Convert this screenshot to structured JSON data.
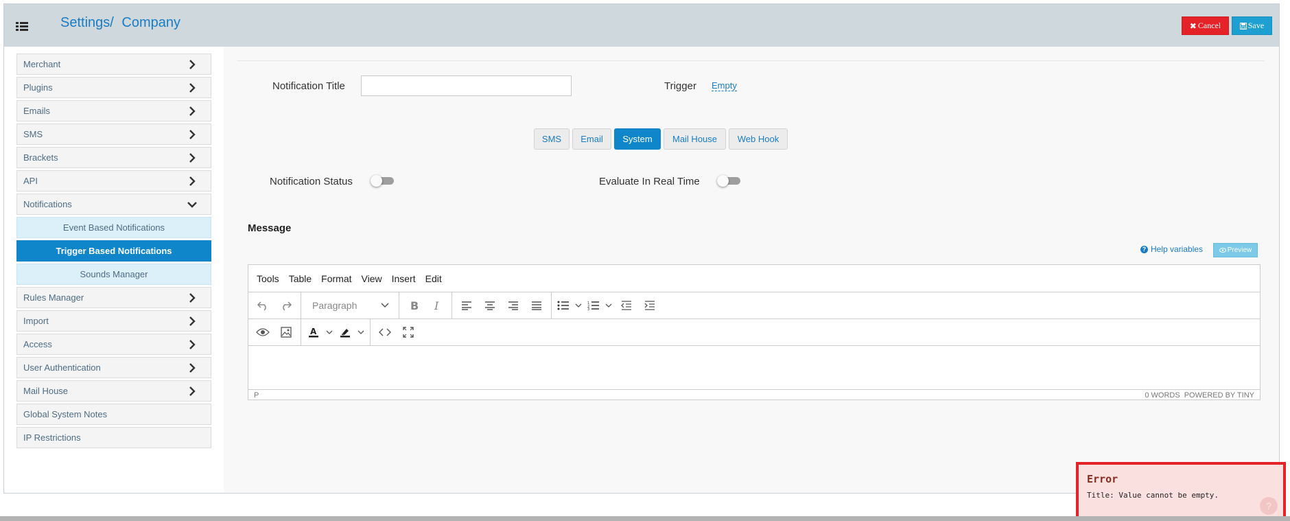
{
  "header": {
    "breadcrumb_root": "Settings/",
    "breadcrumb_current": "Company",
    "cancel_label": "Cancel",
    "save_label": "Save"
  },
  "sidebar": {
    "items": [
      {
        "label": "Merchant",
        "chevron": "right"
      },
      {
        "label": "Plugins",
        "chevron": "right"
      },
      {
        "label": "Emails",
        "chevron": "right"
      },
      {
        "label": "SMS",
        "chevron": "right"
      },
      {
        "label": "Brackets",
        "chevron": "right"
      },
      {
        "label": "API",
        "chevron": "right"
      },
      {
        "label": "Notifications",
        "chevron": "down"
      }
    ],
    "sub_items": [
      {
        "label": "Event Based Notifications",
        "active": false
      },
      {
        "label": "Trigger Based Notifications",
        "active": true
      },
      {
        "label": "Sounds Manager",
        "active": false
      }
    ],
    "items_after": [
      {
        "label": "Rules Manager",
        "chevron": "right"
      },
      {
        "label": "Import",
        "chevron": "right"
      },
      {
        "label": "Access",
        "chevron": "right"
      },
      {
        "label": "User Authentication",
        "chevron": "right"
      },
      {
        "label": "Mail House",
        "chevron": "right"
      },
      {
        "label": "Global System Notes",
        "chevron": "none"
      },
      {
        "label": "IP Restrictions",
        "chevron": "none"
      }
    ]
  },
  "form": {
    "notification_title_label": "Notification Title",
    "notification_title_value": "",
    "trigger_label": "Trigger",
    "trigger_value": "Empty",
    "tabs": [
      "SMS",
      "Email",
      "System",
      "Mail House",
      "Web Hook"
    ],
    "active_tab": "System",
    "notification_status_label": "Notification Status",
    "notification_status_on": false,
    "evaluate_real_time_label": "Evaluate In Real Time",
    "evaluate_real_time_on": false,
    "message_heading": "Message",
    "help_variables_label": "Help variables",
    "preview_label": "Preview"
  },
  "editor": {
    "menu": [
      "Tools",
      "Table",
      "Format",
      "View",
      "Insert",
      "Edit"
    ],
    "block_format": "Paragraph",
    "status_path": "P",
    "word_count": "0 WORDS",
    "powered_by": "POWERED BY TINY"
  },
  "toast": {
    "title": "Error",
    "message": "Title: Value cannot be empty."
  },
  "colors": {
    "accent_blue": "#0e86c9",
    "link_blue": "#1a7cc4",
    "cancel_red": "#e52228",
    "save_blue": "#1e9fd1",
    "header_bg": "#cfd8dc",
    "toast_bg": "#fbe0e0"
  }
}
